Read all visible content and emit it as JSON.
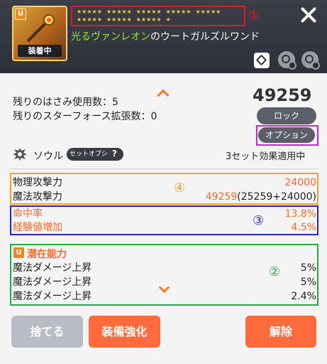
{
  "header": {
    "badge": "U",
    "equipped_label": "装着中",
    "stars_row1": [
      "★★★★★",
      "★★★★★",
      "★★★★★",
      "★★★★★",
      "★★★★★"
    ],
    "stars_row2": [
      "★★★★★",
      "★★★★★",
      "★★★★★",
      "★"
    ],
    "marker1": "①",
    "name_prefix": "光るヴァンレオン",
    "name_suffix": "のウートガルズルワンド"
  },
  "info": {
    "scissors_line": "残りのはさみ使用数：5",
    "starforce_line": "残りのスターフォース拡張数：0",
    "power": "49259",
    "lock_label": "ロック",
    "option_label": "オプション"
  },
  "soul": {
    "label": "ソウル",
    "set_option_label": "セットオプション",
    "help": "?",
    "set_status": "3セット効果適用中"
  },
  "stats": {
    "marker4": "④",
    "physical_attack": {
      "label": "物理攻撃力",
      "value": "24000"
    },
    "magic_attack": {
      "label": "魔法攻撃力",
      "value_main": "49259",
      "value_detail": "(25259+24000)"
    },
    "marker3": "③",
    "accuracy": {
      "label": "命中率",
      "value": "13.8%"
    },
    "exp_boost": {
      "label": "経験値増加",
      "value": "4.5%"
    }
  },
  "potential": {
    "marker2": "②",
    "badge": "U",
    "title": "潜在能力",
    "lines": [
      {
        "label": "魔法ダメージ上昇",
        "value": "5%"
      },
      {
        "label": "魔法ダメージ上昇",
        "value": "5%"
      },
      {
        "label": "魔法ダメージ上昇",
        "value": "2.4%"
      }
    ]
  },
  "footer": {
    "discard_label": "捨てる",
    "enhance_label": "装備強化",
    "unequip_label": "解除"
  },
  "colors": {
    "accent_orange": "#ff6a2a",
    "header_bg": "#2e3039",
    "name_green": "#8ee63a",
    "star_gold": "#f8c92c",
    "box1_red": "#e0182a",
    "box2_green": "#26a844",
    "box3_blue": "#2424c8",
    "box4_orange": "#f2a12a",
    "option_box_magenta": "#d81fd8"
  }
}
